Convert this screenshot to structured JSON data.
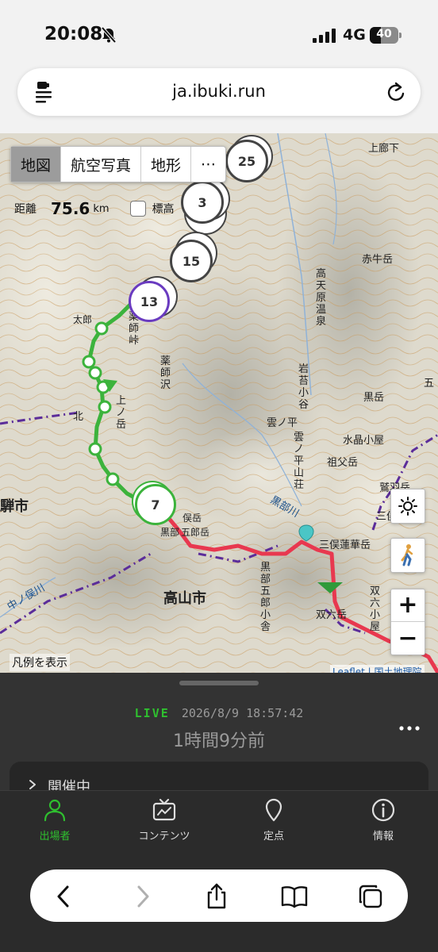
{
  "status_bar": {
    "time": "20:08",
    "network": "4G",
    "battery": 40,
    "battery_label": "40",
    "icons": [
      "bell-slash-icon",
      "signal-icon",
      "battery-icon"
    ]
  },
  "browser": {
    "url": "ja.ibuki.run",
    "icons": [
      "page-menu-icon",
      "reload-icon"
    ]
  },
  "map": {
    "layer_tabs": [
      {
        "label": "地図",
        "active": true
      },
      {
        "label": "航空写真",
        "active": false
      },
      {
        "label": "地形",
        "active": false
      },
      {
        "label": "⋯",
        "active": false
      }
    ],
    "distance": {
      "label": "距離",
      "value": "75.6",
      "unit": "km"
    },
    "elevation_toggle": {
      "label": "標高",
      "checked": false
    },
    "clusters": {
      "c25": "25",
      "c3": "3",
      "c15": "15",
      "c13": "13",
      "c7": "7"
    },
    "place_labels": {
      "takayama": "高山市",
      "hida": "騨市",
      "kamodaaka": "上廊下",
      "akaushi": "赤牛岳",
      "takamagahara": "高天原温泉",
      "iwaobetsu": "岩苔小谷",
      "kurobe": "黒岳",
      "kumonotaira": "雲ノ平",
      "kumonotaira_sanso": "雲ノ平山荘",
      "suisho_hut": "水晶小屋",
      "sofu": "祖父岳",
      "washiba": "鷲羽岳",
      "mitsumata": "三俣山荘",
      "kurobegawa": "黒部川",
      "mitsumata_renge": "三俣蓮華岳",
      "kurobe_goro": "黒部五郎小舎",
      "kurobe_goro_dake": "黒部五郎岳",
      "sugoroku_hut": "双六小屋",
      "sugoroku_dake": "双六岳",
      "nakamatagawa": "中ノ俣川",
      "tarou": "太郎",
      "yakushi_pass": "薬師峠",
      "yakushizawa": "薬師沢",
      "kaminodake": "上ノ岳",
      "kita": "北",
      "itsutsu": "五",
      "kurobe_small": "黒部",
      "goro_small": "五郎岳",
      "ono": "俣岳"
    },
    "controls": {
      "sun_icon": "sun-icon",
      "walker_icon": "walker-icon",
      "zoom_in": "+",
      "zoom_out": "−"
    },
    "legend_link": "凡例を表示",
    "attribution": "Leaflet | 国土地理院"
  },
  "panel": {
    "live_label": "LIVE",
    "live_time": "2026/8/9 18:57:42",
    "ago": "1時間9分前",
    "status_card_label": "開催中"
  },
  "tabbar": {
    "items": [
      {
        "label": "出場者",
        "icon": "person-icon",
        "active": true
      },
      {
        "label": "コンテンツ",
        "icon": "tv-icon",
        "active": false
      },
      {
        "label": "定点",
        "icon": "pin-icon",
        "active": false
      },
      {
        "label": "情報",
        "icon": "info-icon",
        "active": false
      }
    ]
  },
  "safari_toolbar": {
    "icons": [
      "back-icon",
      "forward-icon",
      "share-icon",
      "bookmarks-icon",
      "tabs-icon"
    ]
  },
  "colors": {
    "live_green": "#2fbf2f",
    "route_green": "#3cb33c",
    "route_red": "#e8384f",
    "route_purple": "#5b2d9a",
    "cluster_purple": "#6a3bc0"
  }
}
